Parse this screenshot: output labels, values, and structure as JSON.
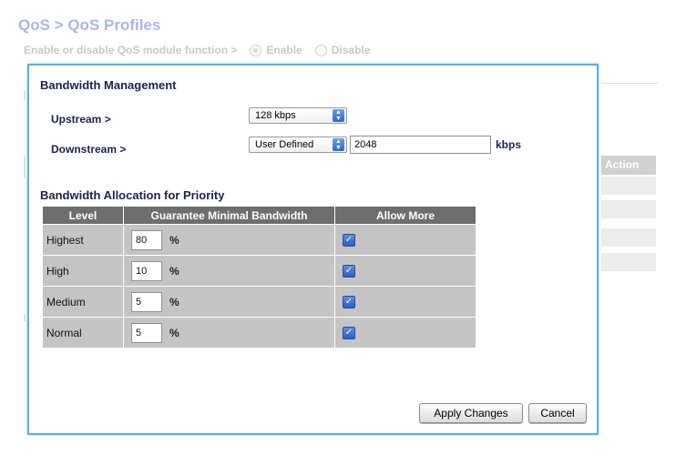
{
  "background": {
    "title": "QoS > QoS Profiles",
    "toggle_label": "Enable or disable QoS module function >",
    "enable_label": "Enable",
    "disable_label": "Disable",
    "enable_selected": true,
    "table_action_header": "Action"
  },
  "modal": {
    "bandwidth_title": "Bandwidth Management",
    "upstream_label": "Upstream >",
    "upstream_value": "128 kbps",
    "downstream_label": "Downstream >",
    "downstream_select": "User Defined",
    "downstream_value": "2048",
    "downstream_unit": "kbps",
    "allocation_title": "Bandwidth Allocation for Priority",
    "table": {
      "headers": [
        "Level",
        "Guarantee Minimal Bandwidth",
        "Allow More"
      ],
      "rows": [
        {
          "level": "Highest",
          "bandwidth": "80",
          "allow_more": true
        },
        {
          "level": "High",
          "bandwidth": "10",
          "allow_more": true
        },
        {
          "level": "Medium",
          "bandwidth": "5",
          "allow_more": true
        },
        {
          "level": "Normal",
          "bandwidth": "5",
          "allow_more": true
        }
      ],
      "percent_sign": "%"
    },
    "apply_label": "Apply Changes",
    "cancel_label": "Cancel"
  },
  "colors": {
    "accent_border": "#5aaee8",
    "header_bg": "#6e6e6e",
    "row_bg": "#c4c4c4",
    "title_faded": "#a9b6e8"
  }
}
